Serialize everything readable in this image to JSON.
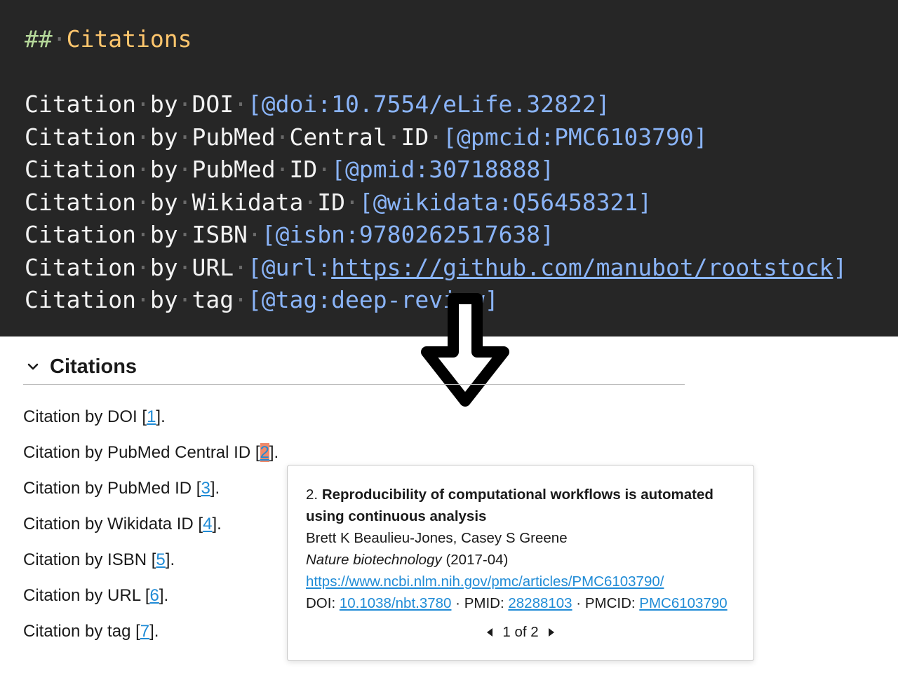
{
  "editor": {
    "heading_hash": "##",
    "heading_text": "Citations",
    "lines": [
      {
        "words": [
          "Citation",
          "by",
          "DOI"
        ],
        "cite": "[@doi:10.7554/eLife.32822]"
      },
      {
        "words": [
          "Citation",
          "by",
          "PubMed",
          "Central",
          "ID"
        ],
        "cite": "[@pmcid:PMC6103790]"
      },
      {
        "words": [
          "Citation",
          "by",
          "PubMed",
          "ID"
        ],
        "cite": "[@pmid:30718888]"
      },
      {
        "words": [
          "Citation",
          "by",
          "Wikidata",
          "ID"
        ],
        "cite": "[@wikidata:Q56458321]"
      },
      {
        "words": [
          "Citation",
          "by",
          "ISBN"
        ],
        "cite": "[@isbn:9780262517638]"
      },
      {
        "words": [
          "Citation",
          "by",
          "URL"
        ],
        "cite_prefix": "[@url:",
        "cite_url": "https://github.com/manubot/rootstock",
        "cite_suffix": "]"
      },
      {
        "words": [
          "Citation",
          "by",
          "tag"
        ],
        "cite": "[@tag:deep-review]"
      }
    ],
    "space_marker": "·"
  },
  "rendered": {
    "section_title": "Citations",
    "paragraphs": [
      {
        "text": "Citation by DOI [",
        "ref": "1",
        "after": "]."
      },
      {
        "text": "Citation by PubMed Central ID [",
        "ref": "2",
        "after": "]."
      },
      {
        "text": "Citation by PubMed ID [",
        "ref": "3",
        "after": "]."
      },
      {
        "text": "Citation by Wikidata ID [",
        "ref": "4",
        "after": "]."
      },
      {
        "text": "Citation by ISBN [",
        "ref": "5",
        "after": "]."
      },
      {
        "text": "Citation by URL [",
        "ref": "6",
        "after": "]."
      },
      {
        "text": "Citation by tag [",
        "ref": "7",
        "after": "]."
      }
    ]
  },
  "tooltip": {
    "number": "2.",
    "title": "Reproducibility of computational workflows is automated using continuous analysis",
    "authors": "Brett K Beaulieu-Jones, Casey S Greene",
    "journal": "Nature biotechnology",
    "date": "(2017-04)",
    "url": "https://www.ncbi.nlm.nih.gov/pmc/articles/PMC6103790/",
    "doi_label": "DOI:",
    "doi": "10.1038/nbt.3780",
    "sep": "·",
    "pmid_label": "PMID:",
    "pmid": "28288103",
    "pmcid_label": "PMCID:",
    "pmcid": "PMC6103790",
    "pager": "1 of 2"
  },
  "colors": {
    "editor_bg": "#262626",
    "heading": "#ffc66d",
    "citation_key": "#8ab4f8",
    "link": "#1f8bd6",
    "highlight": "#f08a6b"
  }
}
